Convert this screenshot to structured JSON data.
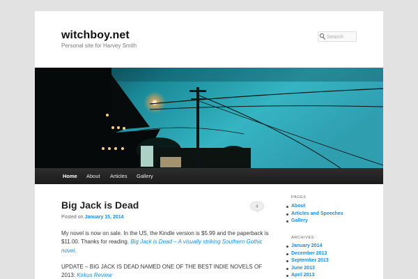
{
  "site": {
    "title": "witchboy.net",
    "description": "Personal site for Harvey Smith"
  },
  "search": {
    "placeholder": "Search"
  },
  "nav": {
    "items": [
      {
        "label": "Home",
        "active": true
      },
      {
        "label": "About"
      },
      {
        "label": "Articles"
      },
      {
        "label": "Gallery"
      }
    ]
  },
  "post": {
    "title": "Big Jack is Dead",
    "comments": "4",
    "posted_on_label": "Posted on",
    "date": "January 15, 2014",
    "para1_text": "My novel is now on sale. In the US, the Kindle version is $5.99 and the paperback is $11.00. Thanks for reading. ",
    "para1_link": "Big Jack is Dead – A visually striking Southern Gothic novel",
    "para1_end": ".",
    "para2_text": "UPDATE – BIG JACK IS DEAD NAMED ONE OF THE BEST INDIE NOVELS OF 2013: ",
    "para2_link": "Kirkus Review"
  },
  "sidebar": {
    "pages_title": "Pages",
    "pages": [
      "About",
      "Articles and Speeches",
      "Gallery"
    ],
    "archives_title": "Archives",
    "archives": [
      "January 2014",
      "December 2013",
      "September 2013",
      "June 2013",
      "April 2013"
    ]
  },
  "colors": {
    "link": "#1b8be0",
    "nav_bg": "#222222",
    "page_bg": "#e2e2e2"
  }
}
